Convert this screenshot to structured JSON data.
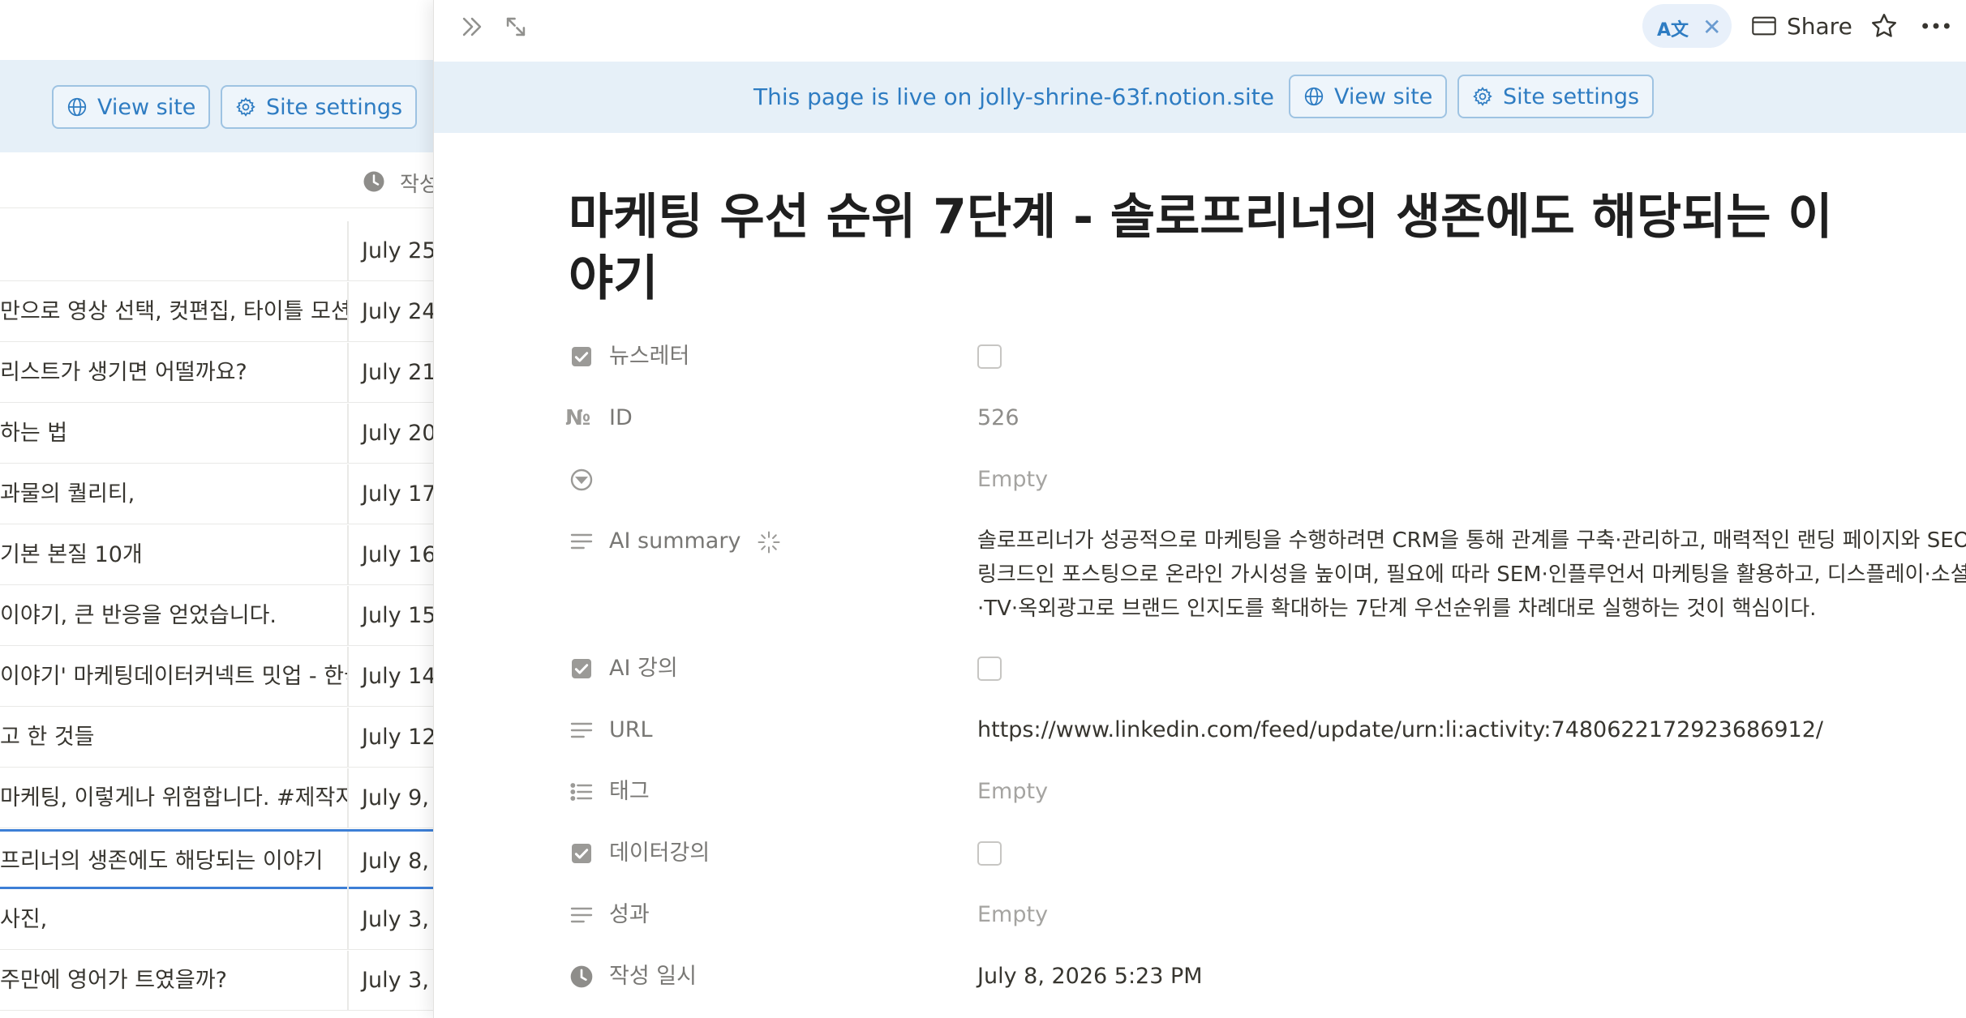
{
  "left": {
    "view_site_label": "View site",
    "site_settings_label": "Site settings",
    "column_header_label": "작성",
    "rows": [
      {
        "title": "",
        "date": "July 25"
      },
      {
        "title": "만으로 영상 선택, 컷편집, 타이틀 모션",
        "date": "July 24"
      },
      {
        "title": "리스트가 생기면 어떨까요?",
        "date": "July 21"
      },
      {
        "title": "하는 법",
        "date": "July 20"
      },
      {
        "title": "과물의 퀄리티,",
        "date": "July 17"
      },
      {
        "title": "기본 본질 10개",
        "date": "July 16"
      },
      {
        "title": "이야기, 큰 반응을 얻었습니다.",
        "date": "July 15"
      },
      {
        "title": "이야기' 마케팅데이터커넥트 밋업 - 한국",
        "date": "July 14"
      },
      {
        "title": "고 한 것들",
        "date": "July 12"
      },
      {
        "title": "마케팅, 이렇게나 위험합니다. #제작지원",
        "date": "July 9,"
      },
      {
        "title": "프리너의 생존에도 해당되는 이야기",
        "date": "July 8,"
      },
      {
        "title": "사진,",
        "date": "July 3,"
      },
      {
        "title": "주만에 영어가 트였을까?",
        "date": "July 3,"
      }
    ]
  },
  "topbar": {
    "share_label": "Share",
    "translate_icon_text": "A文"
  },
  "banner": {
    "text": "This page is live on jolly-shrine-63f.notion.site",
    "view_site_label": "View site",
    "site_settings_label": "Site settings"
  },
  "page": {
    "title": "마케팅 우선 순위 7단계 - 솔로프리너의 생존에도 해당되는 이야기",
    "properties": {
      "newsletter": {
        "name": "뉴스레터",
        "checked": false
      },
      "id": {
        "name": "ID",
        "value": "526"
      },
      "status": {
        "name": "",
        "value": "Empty"
      },
      "ai_summary": {
        "name": "AI summary",
        "value": "솔로프리너가 성공적으로 마케팅을 수행하려면 CRM을 통해 관계를 구축·관리하고, 매력적인 랜딩 페이지와 SEO·링크드인 포스팅으로 온라인 가시성을 높이며, 필요에 따라 SEM·인플루언서 마케팅을 활용하고, 디스플레이·소셜·TV·옥외광고로 브랜드 인지도를 확대하는 7단계 우선순위를 차례대로 실행하는 것이 핵심이다."
      },
      "ai_lecture": {
        "name": "AI 강의",
        "checked": false
      },
      "url": {
        "name": "URL",
        "value": "https://www.linkedin.com/feed/update/urn:li:activity:7480622172923686912/"
      },
      "tags": {
        "name": "태그",
        "value": "Empty"
      },
      "data_lecture": {
        "name": "데이터강의",
        "checked": false
      },
      "result": {
        "name": "성과",
        "value": "Empty"
      },
      "created": {
        "name": "작성 일시",
        "value": "July 8, 2026 5:23 PM"
      }
    }
  },
  "colors": {
    "accent": "#2e7cc2",
    "banner_bg": "#e6f0f8",
    "selected_row_border": "#3d7fd6",
    "text": "#37352f",
    "muted": "#787774"
  }
}
